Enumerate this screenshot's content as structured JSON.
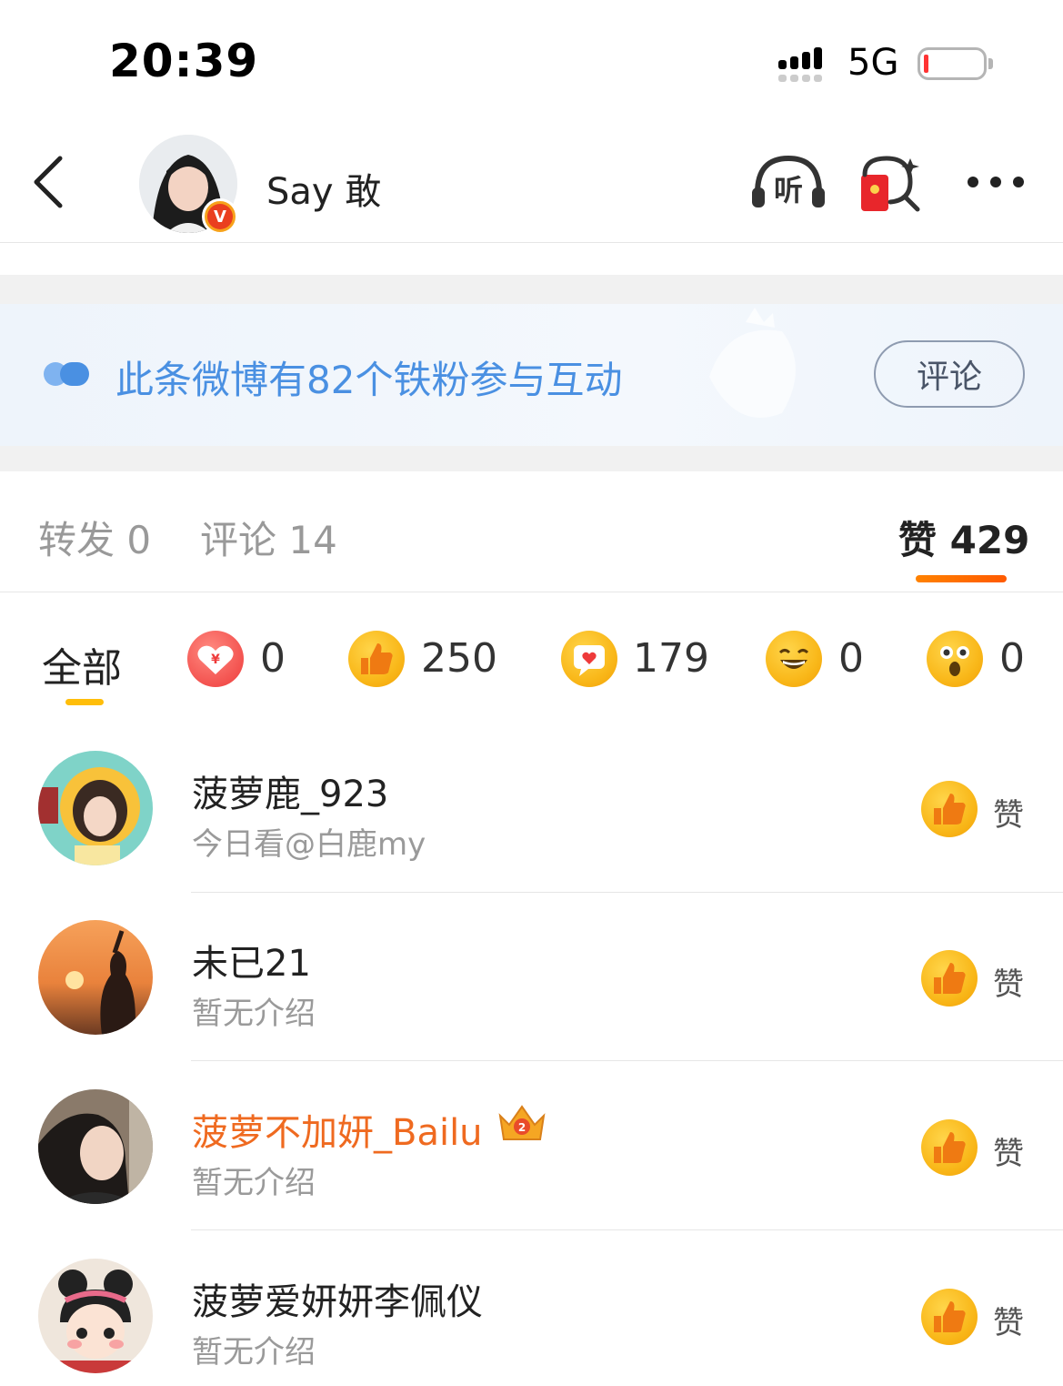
{
  "status_bar": {
    "time": "20:39",
    "network": "5G"
  },
  "header": {
    "username": "Say 敢",
    "verified_badge": "V",
    "listen_label": "听"
  },
  "fan_banner": {
    "text": "此条微博有82个铁粉参与互动",
    "button": "评论"
  },
  "tabs": {
    "forward": "转发 0",
    "comment": "评论 14",
    "like": "赞 429"
  },
  "reactions": {
    "all_label": "全部",
    "items": [
      {
        "icon": "red-heart-yuan-icon",
        "count": "0"
      },
      {
        "icon": "thumbs-up-icon",
        "count": "250"
      },
      {
        "icon": "heart-bubble-icon",
        "count": "179"
      },
      {
        "icon": "laughing-face-icon",
        "count": "0"
      },
      {
        "icon": "surprised-face-icon",
        "count": "0"
      }
    ]
  },
  "likers": [
    {
      "name": "菠萝鹿_923",
      "desc": "今日看@白鹿my",
      "like_label": "赞",
      "vip": false
    },
    {
      "name": "未已21",
      "desc": "暂无介绍",
      "like_label": "赞",
      "vip": false
    },
    {
      "name": "菠萝不加妍_Bailu",
      "desc": "暂无介绍",
      "like_label": "赞",
      "vip": true
    },
    {
      "name": "菠萝爱妍妍李佩仪",
      "desc": "暂无介绍",
      "like_label": "赞",
      "vip": false
    }
  ],
  "colors": {
    "accent_orange": "#ff8200",
    "link_blue": "#4a90e2",
    "tab_yellow": "#ffbe0a",
    "vip_name": "#ef6a20"
  }
}
